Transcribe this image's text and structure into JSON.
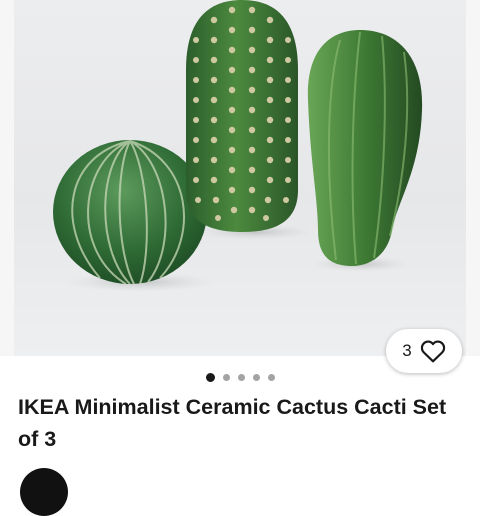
{
  "listing": {
    "title": "IKEA Minimalist Ceramic Cactus Cacti Set of 3",
    "likes": "3",
    "photo_count": 5,
    "active_photo": 1
  },
  "icons": {
    "like": "heart-outline-icon"
  },
  "colors": {
    "text": "#191919",
    "dot_active": "#191919",
    "dot_inactive": "#a3a3a3"
  }
}
